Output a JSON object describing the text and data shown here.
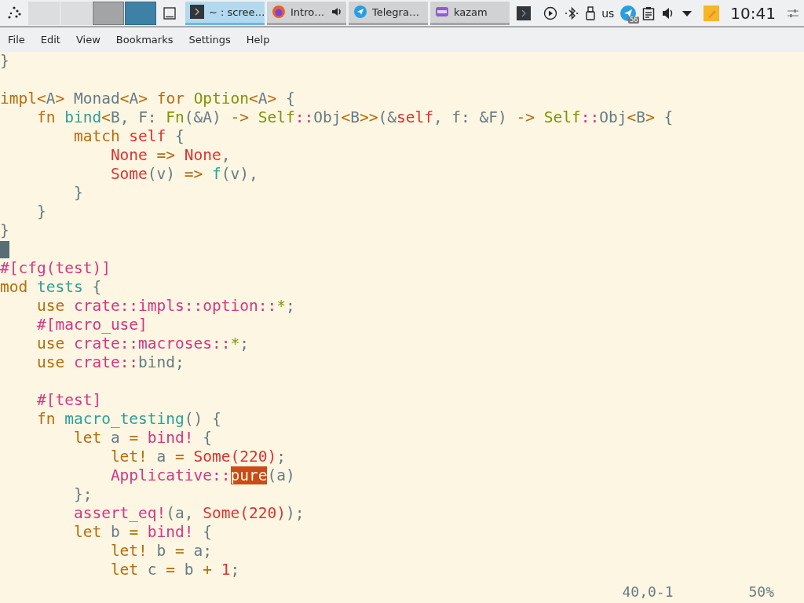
{
  "panel": {
    "desktops": [
      {
        "selected": false,
        "occupied": false
      },
      {
        "selected": false,
        "occupied": false
      },
      {
        "selected": false,
        "occupied": true
      },
      {
        "selected": true,
        "occupied": true
      }
    ],
    "tasks": [
      {
        "kind": "terminal",
        "label": "~ : scree…",
        "selected": true,
        "audio": false
      },
      {
        "kind": "browser",
        "label": "Intro…",
        "selected": false,
        "audio": true
      },
      {
        "kind": "messenger",
        "label": "Telegra…",
        "selected": false,
        "audio": false
      },
      {
        "kind": "recorder",
        "label": "kazam",
        "selected": false,
        "audio": false
      }
    ],
    "tray": {
      "keyboard_layout": "us",
      "badge": "56",
      "clock": "10:41"
    }
  },
  "menu": [
    "File",
    "Edit",
    "View",
    "Bookmarks",
    "Settings",
    "Help"
  ],
  "editor": {
    "lines": [
      {
        "kind": "code",
        "tokens": [
          {
            "kind": "txt",
            "text": "}"
          }
        ]
      },
      {
        "kind": "blank"
      },
      {
        "kind": "code",
        "tokens": [
          {
            "kind": "kw",
            "text": "impl"
          },
          {
            "kind": "op",
            "text": "<"
          },
          {
            "kind": "txt",
            "text": "A"
          },
          {
            "kind": "op",
            "text": ">"
          },
          {
            "kind": "txt",
            "text": " Monad"
          },
          {
            "kind": "op",
            "text": "<"
          },
          {
            "kind": "txt",
            "text": "A"
          },
          {
            "kind": "op",
            "text": ">"
          },
          {
            "kind": "kw",
            "text": " for"
          },
          {
            "kind": "typ",
            "text": " Option"
          },
          {
            "kind": "op",
            "text": "<"
          },
          {
            "kind": "txt",
            "text": "A"
          },
          {
            "kind": "op",
            "text": ">"
          },
          {
            "kind": "txt",
            "text": " {"
          }
        ]
      },
      {
        "kind": "code",
        "tokens": [
          {
            "kind": "kw",
            "text": "    fn"
          },
          {
            "kind": "fn",
            "text": " bind"
          },
          {
            "kind": "op",
            "text": "<"
          },
          {
            "kind": "txt",
            "text": "B, F: "
          },
          {
            "kind": "typ",
            "text": "Fn"
          },
          {
            "kind": "txt",
            "text": "(&A) "
          },
          {
            "kind": "op",
            "text": "->"
          },
          {
            "kind": "typ",
            "text": " Self"
          },
          {
            "kind": "mac",
            "text": "::"
          },
          {
            "kind": "txt",
            "text": "Obj"
          },
          {
            "kind": "op",
            "text": "<"
          },
          {
            "kind": "txt",
            "text": "B"
          },
          {
            "kind": "op",
            "text": ">>"
          },
          {
            "kind": "txt",
            "text": "(&"
          },
          {
            "kind": "con",
            "text": "self"
          },
          {
            "kind": "txt",
            "text": ", f: &F) "
          },
          {
            "kind": "op",
            "text": "->"
          },
          {
            "kind": "typ",
            "text": " Self"
          },
          {
            "kind": "mac",
            "text": "::"
          },
          {
            "kind": "txt",
            "text": "Obj"
          },
          {
            "kind": "op",
            "text": "<"
          },
          {
            "kind": "txt",
            "text": "B"
          },
          {
            "kind": "op",
            "text": ">"
          },
          {
            "kind": "txt",
            "text": " {"
          }
        ]
      },
      {
        "kind": "code",
        "tokens": [
          {
            "kind": "kw",
            "text": "        match"
          },
          {
            "kind": "con",
            "text": " self"
          },
          {
            "kind": "txt",
            "text": " {"
          }
        ]
      },
      {
        "kind": "code",
        "tokens": [
          {
            "kind": "con",
            "text": "            None"
          },
          {
            "kind": "op",
            "text": " =>"
          },
          {
            "kind": "con",
            "text": " None"
          },
          {
            "kind": "txt",
            "text": ","
          }
        ]
      },
      {
        "kind": "code",
        "tokens": [
          {
            "kind": "con",
            "text": "            Some"
          },
          {
            "kind": "txt",
            "text": "(v) "
          },
          {
            "kind": "op",
            "text": "=>"
          },
          {
            "kind": "fn",
            "text": " f"
          },
          {
            "kind": "txt",
            "text": "(v),"
          }
        ]
      },
      {
        "kind": "code",
        "tokens": [
          {
            "kind": "txt",
            "text": "        }"
          }
        ]
      },
      {
        "kind": "code",
        "tokens": [
          {
            "kind": "txt",
            "text": "    }"
          }
        ]
      },
      {
        "kind": "code",
        "tokens": [
          {
            "kind": "txt",
            "text": "}"
          }
        ]
      },
      {
        "kind": "cursor"
      },
      {
        "kind": "code",
        "tokens": [
          {
            "kind": "mac",
            "text": "#[cfg(test)]"
          }
        ]
      },
      {
        "kind": "code",
        "tokens": [
          {
            "kind": "kw",
            "text": "mod"
          },
          {
            "kind": "fn",
            "text": " tests"
          },
          {
            "kind": "txt",
            "text": " {"
          }
        ]
      },
      {
        "kind": "code",
        "tokens": [
          {
            "kind": "kw",
            "text": "    use"
          },
          {
            "kind": "mac",
            "text": " crate::impls::option::"
          },
          {
            "kind": "typ",
            "text": "*"
          },
          {
            "kind": "txt",
            "text": ";"
          }
        ]
      },
      {
        "kind": "code",
        "tokens": [
          {
            "kind": "mac",
            "text": "    #[macro_use]"
          }
        ]
      },
      {
        "kind": "code",
        "tokens": [
          {
            "kind": "kw",
            "text": "    use"
          },
          {
            "kind": "mac",
            "text": " crate::macroses::"
          },
          {
            "kind": "typ",
            "text": "*"
          },
          {
            "kind": "txt",
            "text": ";"
          }
        ]
      },
      {
        "kind": "code",
        "tokens": [
          {
            "kind": "kw",
            "text": "    use"
          },
          {
            "kind": "mac",
            "text": " crate::"
          },
          {
            "kind": "txt",
            "text": "bind;"
          }
        ]
      },
      {
        "kind": "blank"
      },
      {
        "kind": "code",
        "tokens": [
          {
            "kind": "mac",
            "text": "    #[test]"
          }
        ]
      },
      {
        "kind": "code",
        "tokens": [
          {
            "kind": "kw",
            "text": "    fn"
          },
          {
            "kind": "fn",
            "text": " macro_testing"
          },
          {
            "kind": "txt",
            "text": "() {"
          }
        ]
      },
      {
        "kind": "code",
        "tokens": [
          {
            "kind": "kw",
            "text": "        let"
          },
          {
            "kind": "txt",
            "text": " a "
          },
          {
            "kind": "op",
            "text": "="
          },
          {
            "kind": "mac",
            "text": " bind!"
          },
          {
            "kind": "txt",
            "text": " {"
          }
        ]
      },
      {
        "kind": "code",
        "tokens": [
          {
            "kind": "kw",
            "text": "            let!"
          },
          {
            "kind": "txt",
            "text": " a "
          },
          {
            "kind": "op",
            "text": "="
          },
          {
            "kind": "con",
            "text": " Some(220)"
          },
          {
            "kind": "txt",
            "text": ";"
          }
        ]
      },
      {
        "kind": "code",
        "tokens": [
          {
            "kind": "mac",
            "text": "            Applicative::"
          },
          {
            "kind": "match",
            "text": "pure"
          },
          {
            "kind": "txt",
            "text": "(a)"
          }
        ]
      },
      {
        "kind": "code",
        "tokens": [
          {
            "kind": "txt",
            "text": "        };"
          }
        ]
      },
      {
        "kind": "code",
        "tokens": [
          {
            "kind": "mac",
            "text": "        assert_eq!"
          },
          {
            "kind": "txt",
            "text": "(a, "
          },
          {
            "kind": "con",
            "text": "Some(220)"
          },
          {
            "kind": "txt",
            "text": ");"
          }
        ]
      },
      {
        "kind": "code",
        "tokens": [
          {
            "kind": "kw",
            "text": "        let"
          },
          {
            "kind": "txt",
            "text": " b "
          },
          {
            "kind": "op",
            "text": "="
          },
          {
            "kind": "mac",
            "text": " bind!"
          },
          {
            "kind": "txt",
            "text": " {"
          }
        ]
      },
      {
        "kind": "code",
        "tokens": [
          {
            "kind": "kw",
            "text": "            let!"
          },
          {
            "kind": "txt",
            "text": " b "
          },
          {
            "kind": "op",
            "text": "="
          },
          {
            "kind": "txt",
            "text": " a;"
          }
        ]
      },
      {
        "kind": "code",
        "tokens": [
          {
            "kind": "kw",
            "text": "            let"
          },
          {
            "kind": "txt",
            "text": " c "
          },
          {
            "kind": "op",
            "text": "="
          },
          {
            "kind": "txt",
            "text": " b "
          },
          {
            "kind": "op",
            "text": "+"
          },
          {
            "kind": "con",
            "text": " 1"
          },
          {
            "kind": "txt",
            "text": ";"
          }
        ]
      }
    ],
    "status": {
      "position": "40,0-1",
      "scroll": "50%"
    }
  }
}
